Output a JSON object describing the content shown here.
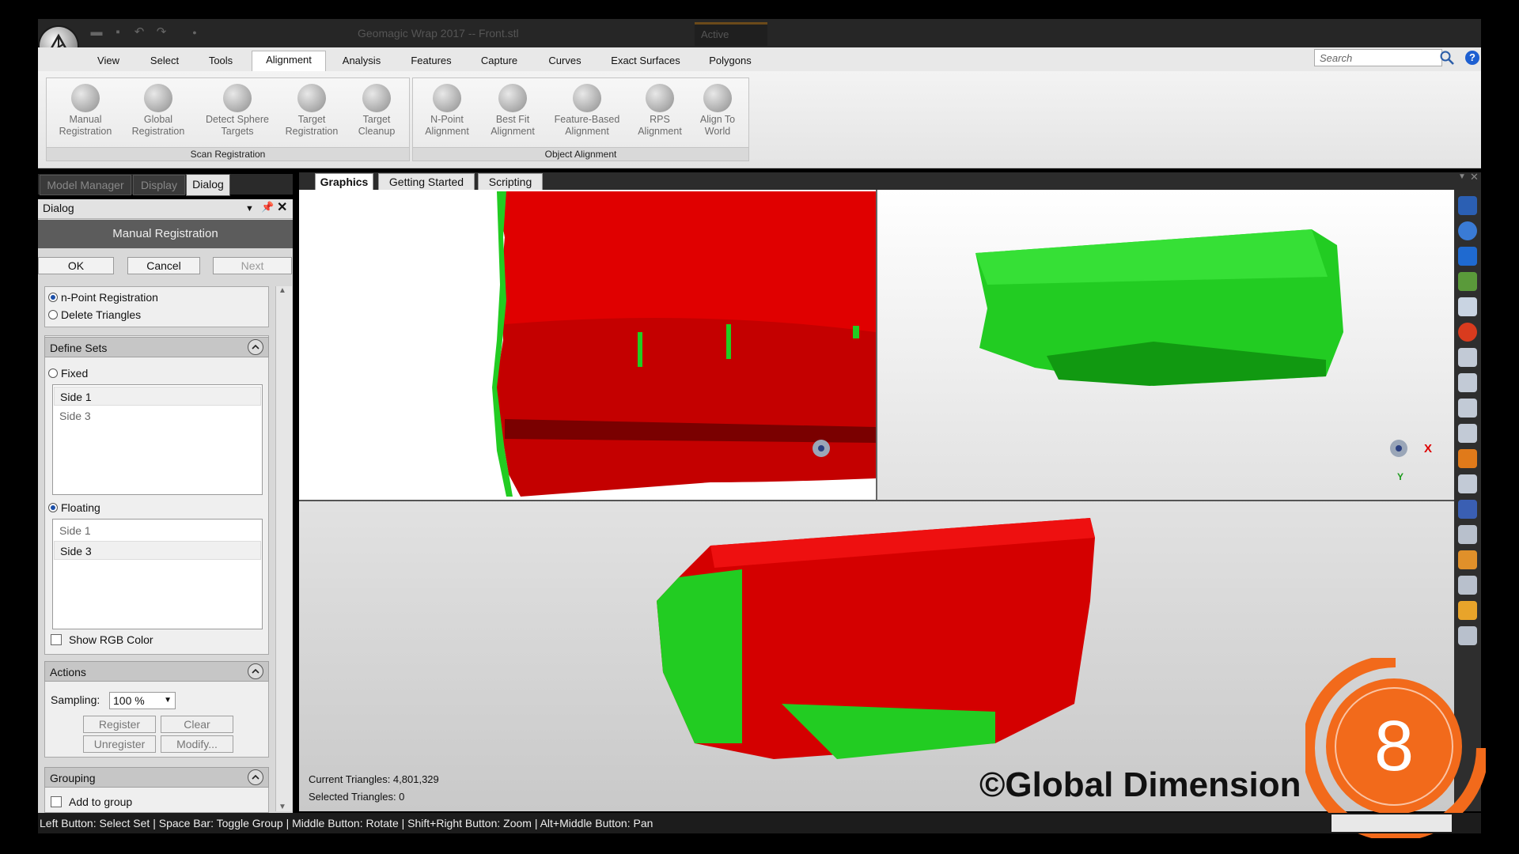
{
  "titlebar": {
    "title": "Geomagic Wrap 2017 -- Front.stl",
    "context_tab": "Active"
  },
  "ribbon": {
    "tabs": [
      "View",
      "Select",
      "Tools",
      "Alignment",
      "Analysis",
      "Features",
      "Capture",
      "Curves",
      "Exact Surfaces",
      "Polygons"
    ],
    "active_tab": "Alignment",
    "search_placeholder": "Search",
    "help": "?",
    "groups": [
      {
        "label": "Scan Registration",
        "buttons": [
          [
            "Manual",
            "Registration"
          ],
          [
            "Global",
            "Registration"
          ],
          [
            "Detect Sphere",
            "Targets"
          ],
          [
            "Target",
            "Registration"
          ],
          [
            "Target",
            "Cleanup"
          ]
        ]
      },
      {
        "label": "Object Alignment",
        "buttons": [
          [
            "N-Point",
            "Alignment"
          ],
          [
            "Best Fit",
            "Alignment"
          ],
          [
            "Feature-Based",
            "Alignment"
          ],
          [
            "RPS",
            "Alignment"
          ],
          [
            "Align To",
            "World"
          ]
        ]
      }
    ]
  },
  "panel": {
    "tabs": [
      "Model Manager",
      "Display",
      "Dialog"
    ],
    "active_tab": "Dialog",
    "title": "Dialog",
    "heading": "Manual Registration",
    "ok": "OK",
    "cancel": "Cancel",
    "next": "Next",
    "mode_options": [
      "n-Point Registration",
      "Delete Triangles"
    ],
    "define_sets": {
      "label": "Define Sets",
      "fixed": "Fixed",
      "fixed_items": [
        "Side 1",
        "Side 3"
      ],
      "floating": "Floating",
      "floating_items": [
        "Side 1",
        "Side 3"
      ],
      "show_rgb": "Show RGB Color"
    },
    "actions": {
      "label": "Actions",
      "sampling_label": "Sampling:",
      "sampling_value": "100 %",
      "register": "Register",
      "clear": "Clear",
      "unregister": "Unregister",
      "modify": "Modify..."
    },
    "grouping": {
      "label": "Grouping",
      "add_to_group": "Add to group"
    }
  },
  "viewport": {
    "tabs": [
      "Graphics",
      "Getting Started",
      "Scripting"
    ],
    "active_tab": "Graphics",
    "current_triangles": "Current Triangles: 4,801,329",
    "selected_triangles": "Selected Triangles: 0",
    "axis_x": "X",
    "axis_y": "Y"
  },
  "overlay": {
    "watermark": "©Global Dimension",
    "step": "8"
  },
  "statusbar": {
    "text": "Left Button: Select Set | Space Bar: Toggle Group | Middle Button: Rotate | Shift+Right Button: Zoom | Alt+Middle Button: Pan"
  },
  "colors": {
    "fixed_mesh": "#e00000",
    "floating_mesh": "#22cc22",
    "badge_orange": "#f26a1b"
  }
}
